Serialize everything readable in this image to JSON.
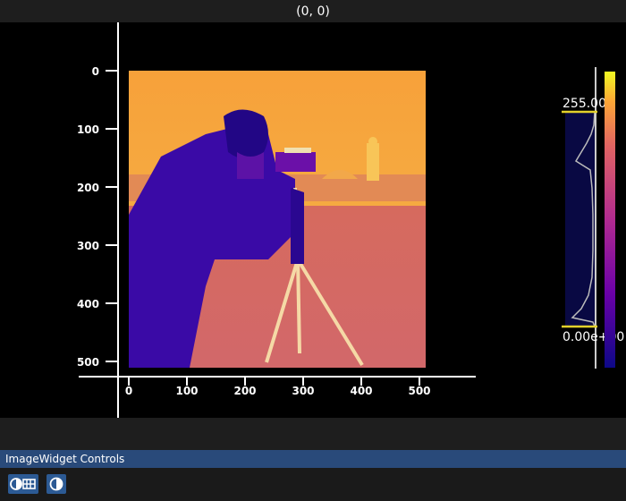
{
  "title": "(0, 0)",
  "figure": {
    "x_ticks": [
      "0",
      "100",
      "200",
      "300",
      "400",
      "500"
    ],
    "y_ticks": [
      "0",
      "100",
      "200",
      "300",
      "400",
      "500"
    ],
    "image": {
      "description": "cameraman",
      "colormap": "plasma",
      "pixel_range": [
        0,
        511
      ]
    }
  },
  "colorbar": {
    "max_label": "255.00",
    "min_label": "0.00e+00",
    "colormap": "plasma"
  },
  "controls": {
    "panel_title": "ImageWidget Controls",
    "buttons": [
      {
        "icon": "contrast-histogram-icon"
      },
      {
        "icon": "contrast-icon"
      }
    ]
  },
  "colors": {
    "background": "#000000",
    "panel_header": "#294a7a",
    "button": "#2c5a94",
    "highlight": "#e3d12b"
  }
}
